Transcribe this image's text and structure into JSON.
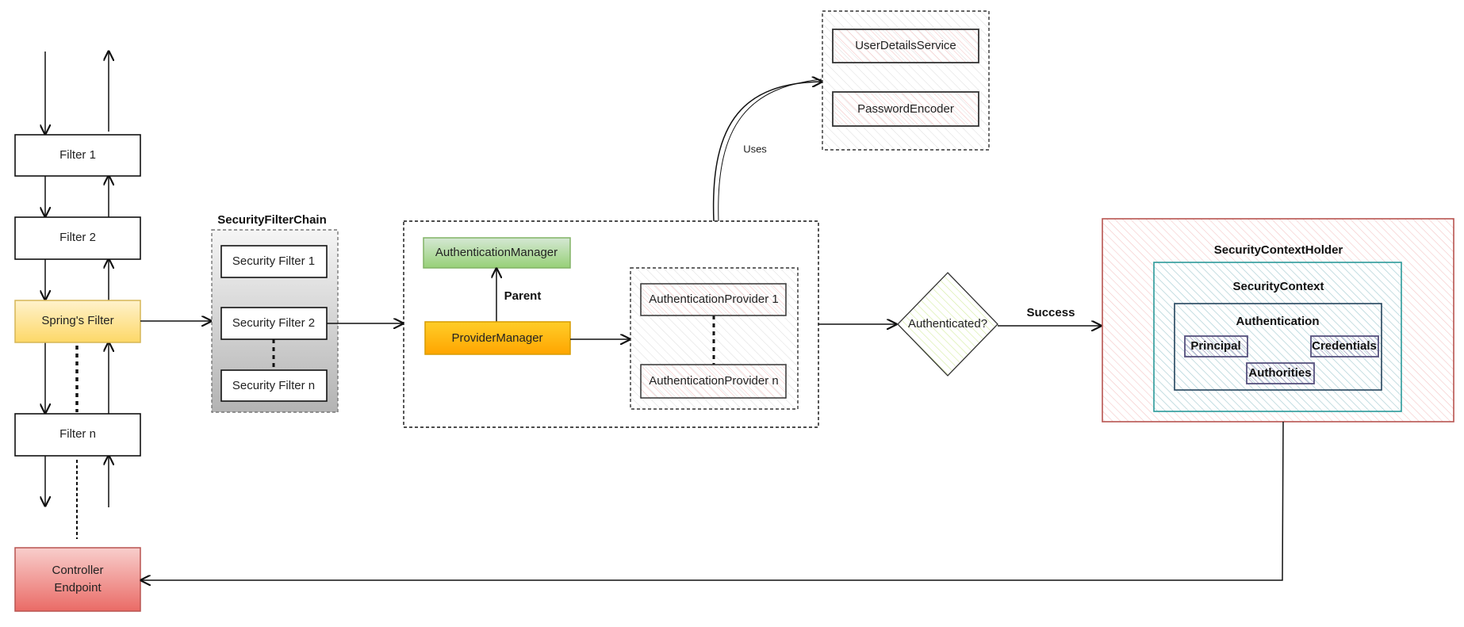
{
  "left_chain": {
    "filters": [
      "Filter 1",
      "Filter 2",
      "Spring's Filter",
      "Filter n"
    ],
    "controller": [
      "Controller",
      "Endpoint"
    ]
  },
  "security_filter_chain": {
    "title": "SecurityFilterChain",
    "filters": [
      "Security Filter 1",
      "Security Filter 2",
      "Security Filter n"
    ]
  },
  "auth_core": {
    "authentication_manager": "AuthenticationManager",
    "provider_manager": "ProviderManager",
    "parent_label": "Parent",
    "providers": [
      "AuthenticationProvider 1",
      "AuthenticationProvider n"
    ]
  },
  "services": {
    "uses_label": "Uses",
    "items": [
      "UserDetailsService",
      "PasswordEncoder"
    ]
  },
  "decision": {
    "question": "Authenticated?",
    "success_label": "Success"
  },
  "context": {
    "holder": "SecurityContextHolder",
    "context": "SecurityContext",
    "authentication": "Authentication",
    "parts": [
      "Principal",
      "Credentials",
      "Authorities"
    ]
  },
  "colors": {
    "spring_filter": "#fdd867",
    "controller": "#ea6b66",
    "auth_manager": "#97d077",
    "provider_manager": "#ffb300",
    "holder_border": "#b85450",
    "context_border": "#2b9a9a",
    "authentication_border": "#23445d",
    "parts_border": "#56517e"
  }
}
